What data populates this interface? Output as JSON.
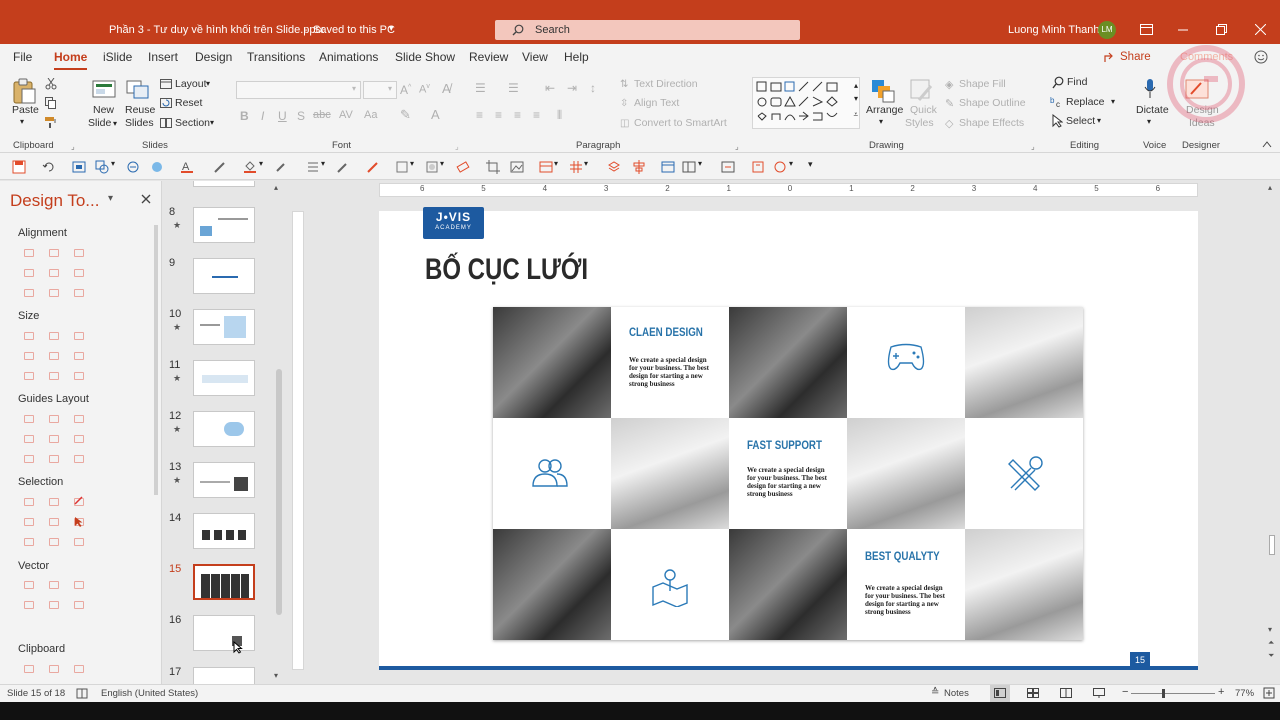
{
  "titlebar": {
    "doc_title": "Phần 3 - Tư duy về hình khối trên Slide.pptx",
    "save_status": "Saved to this PC",
    "search_placeholder": "Search",
    "user_name": "Luong Minh Thanh",
    "user_initials": "LM"
  },
  "tabs": [
    "File",
    "Home",
    "iSlide",
    "Insert",
    "Design",
    "Transitions",
    "Animations",
    "Slide Show",
    "Review",
    "View",
    "Help"
  ],
  "active_tab": "Home",
  "share_label": "Share",
  "comments_label": "Comments",
  "ribbon": {
    "paste": "Paste",
    "new_slide_1": "New",
    "new_slide_2": "Slide",
    "reuse_1": "Reuse",
    "reuse_2": "Slides",
    "layout": "Layout",
    "reset": "Reset",
    "section": "Section",
    "text_direction": "Text Direction",
    "align_text": "Align Text",
    "convert_smartart": "Convert to SmartArt",
    "arrange": "Arrange",
    "quick_styles_1": "Quick",
    "quick_styles_2": "Styles",
    "shape_fill": "Shape Fill",
    "shape_outline": "Shape Outline",
    "shape_effects": "Shape Effects",
    "find": "Find",
    "replace": "Replace",
    "select": "Select",
    "dictate": "Dictate",
    "design_ideas_1": "Design",
    "design_ideas_2": "Ideas",
    "groups": {
      "clipboard": "Clipboard",
      "slides": "Slides",
      "font": "Font",
      "paragraph": "Paragraph",
      "drawing": "Drawing",
      "editing": "Editing",
      "voice": "Voice",
      "designer": "Designer"
    }
  },
  "design_pane": {
    "title": "Design To...",
    "sections": [
      "Alignment",
      "Size",
      "Guides Layout",
      "Selection",
      "Vector",
      "Clipboard"
    ]
  },
  "thumbnails": [
    {
      "num": "8",
      "star": true
    },
    {
      "num": "9",
      "star": false
    },
    {
      "num": "10",
      "star": true
    },
    {
      "num": "11",
      "star": true
    },
    {
      "num": "12",
      "star": true
    },
    {
      "num": "13",
      "star": true
    },
    {
      "num": "14",
      "star": false
    },
    {
      "num": "15",
      "star": false,
      "selected": true
    },
    {
      "num": "16",
      "star": false
    },
    {
      "num": "17",
      "star": false
    }
  ],
  "ruler_labels": [
    "6",
    "5",
    "4",
    "3",
    "2",
    "1",
    "0",
    "1",
    "2",
    "3",
    "4",
    "5",
    "6"
  ],
  "slide": {
    "logo_line1": "J•VIS",
    "logo_line2": "ACADEMY",
    "title": "BỐ CỤC LƯỚI",
    "page_number": "15",
    "cards": [
      {
        "title": "CLAEN DESIGN",
        "desc": "We create a special design for your business. The best design for starting a new strong business"
      },
      {
        "title": "FAST SUPPORT",
        "desc": "We create a special design for your business. The best design for starting a new strong business"
      },
      {
        "title": "BEST QUALYTY",
        "desc": "We create a special design for your business. The best design for starting a new strong business"
      }
    ]
  },
  "status": {
    "slide_info": "Slide 15 of 18",
    "language": "English (United States)",
    "notes": "Notes",
    "zoom": "77%"
  }
}
